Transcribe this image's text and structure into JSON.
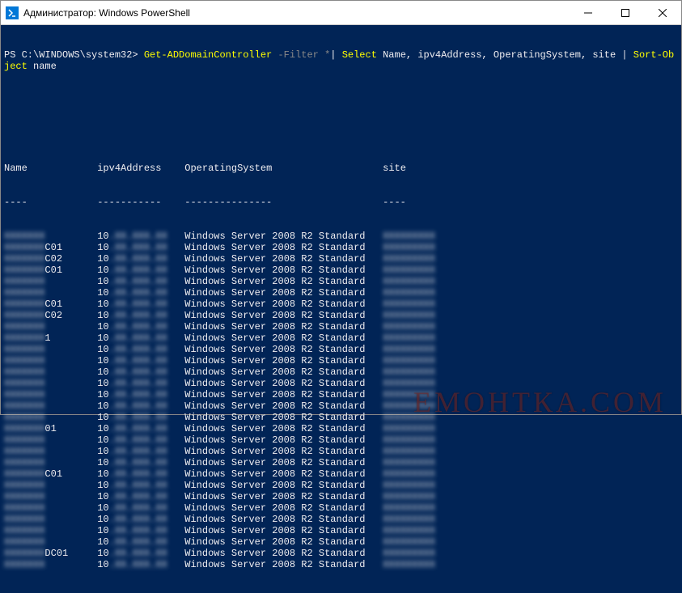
{
  "window": {
    "title": "Администратор: Windows PowerShell",
    "icon_label": ">_"
  },
  "prompt": {
    "prefix": "PS C:\\WINDOWS\\system32> ",
    "cmdlet": "Get-ADDomainController",
    "filter_param": "-Filter *",
    "pipe1": "|",
    "select": "Select",
    "select_args": "Name, ipv4Address, OperatingSystem, site",
    "pipe2": "|",
    "sort": "Sort-Object",
    "sort_arg": "name"
  },
  "headers": {
    "name": "Name",
    "ipv4": "ipv4Address",
    "os": "OperatingSystem",
    "site": "site"
  },
  "os_value": "Windows Server 2008 R2 Standard",
  "rows": [
    {
      "name_tail": "",
      "ip_prefix": "10"
    },
    {
      "name_tail": "C01",
      "ip_prefix": "10"
    },
    {
      "name_tail": "C02",
      "ip_prefix": "10"
    },
    {
      "name_tail": "C01",
      "ip_prefix": "10"
    },
    {
      "name_tail": "",
      "ip_prefix": "10"
    },
    {
      "name_tail": "",
      "ip_prefix": "10"
    },
    {
      "name_tail": "C01",
      "ip_prefix": "10"
    },
    {
      "name_tail": "C02",
      "ip_prefix": "10"
    },
    {
      "name_tail": "",
      "ip_prefix": "10"
    },
    {
      "name_tail": "1",
      "ip_prefix": "10"
    },
    {
      "name_tail": "",
      "ip_prefix": "10"
    },
    {
      "name_tail": "",
      "ip_prefix": "10"
    },
    {
      "name_tail": "",
      "ip_prefix": "10"
    },
    {
      "name_tail": "",
      "ip_prefix": "10"
    },
    {
      "name_tail": "",
      "ip_prefix": "10"
    },
    {
      "name_tail": "",
      "ip_prefix": "10"
    },
    {
      "name_tail": "",
      "ip_prefix": "10"
    },
    {
      "name_tail": "01",
      "ip_prefix": "10"
    },
    {
      "name_tail": "",
      "ip_prefix": "10"
    },
    {
      "name_tail": "",
      "ip_prefix": "10"
    },
    {
      "name_tail": "",
      "ip_prefix": "10"
    },
    {
      "name_tail": "C01",
      "ip_prefix": "10"
    },
    {
      "name_tail": "",
      "ip_prefix": "10"
    },
    {
      "name_tail": "",
      "ip_prefix": "10"
    },
    {
      "name_tail": "",
      "ip_prefix": "10"
    },
    {
      "name_tail": "",
      "ip_prefix": "10"
    },
    {
      "name_tail": "",
      "ip_prefix": "10"
    },
    {
      "name_tail": "",
      "ip_prefix": "10"
    },
    {
      "name_tail": "DC01",
      "ip_prefix": "10"
    },
    {
      "name_tail": "",
      "ip_prefix": "10"
    }
  ],
  "watermark": "ЕМОНТКА.COM"
}
